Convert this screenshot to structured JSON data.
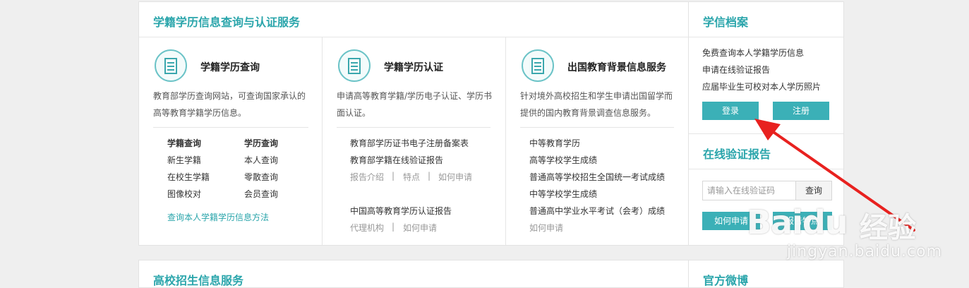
{
  "main": {
    "title": "学籍学历信息查询与认证服务",
    "col1": {
      "title": "学籍学历查询",
      "desc": "教育部学历查询网站，可查询国家承认的高等教育学籍学历信息。",
      "grid": [
        [
          "学籍查询",
          "学历查询"
        ],
        [
          "新生学籍",
          "本人查询"
        ],
        [
          "在校生学籍",
          "零散查询"
        ],
        [
          "图像校对",
          "会员查询"
        ]
      ],
      "link": "查询本人学籍学历信息方法"
    },
    "col2": {
      "title": "学籍学历认证",
      "desc": "申请高等教育学籍/学历电子认证、学历书面认证。",
      "link1": "教育部学历证书电子注册备案表",
      "link2": "教育部学籍在线验证报告",
      "sub1": [
        "报告介绍",
        "特点",
        "如何申请"
      ],
      "link3": "中国高等教育学历认证报告",
      "sub2": [
        "代理机构",
        "如何申请"
      ],
      "sep": "|"
    },
    "col3": {
      "title": "出国教育背景信息服务",
      "desc": "针对境外高校招生和学生申请出国留学而提供的国内教育背景调查信息服务。",
      "items": [
        "中等教育学历",
        "高等学校学生成绩",
        "普通高等学校招生全国统一考试成绩",
        "中等学校学生成绩",
        "普通高中学业水平考试（会考）成绩"
      ],
      "apply": "如何申请"
    }
  },
  "side": {
    "title": "学信档案",
    "lines": [
      "免费查询本人学籍学历信息",
      "申请在线验证报告",
      "应届毕业生可校对本人学历照片"
    ],
    "login": "登录",
    "register": "注册",
    "verify_title": "在线验证报告",
    "search_placeholder": "请输入在线验证码",
    "query": "查询",
    "how_apply": "如何申请",
    "report_feature": "报告特点"
  },
  "bottom": {
    "left_title": "高校招生信息服务",
    "right_title": "官方微博"
  },
  "watermark": {
    "brand": "Baidu",
    "cn": "经验",
    "url": "jingyan.baidu.com"
  },
  "colors": {
    "accent": "#2aa5ab",
    "button": "#3bb0b7",
    "arrow": "#e8211f"
  }
}
